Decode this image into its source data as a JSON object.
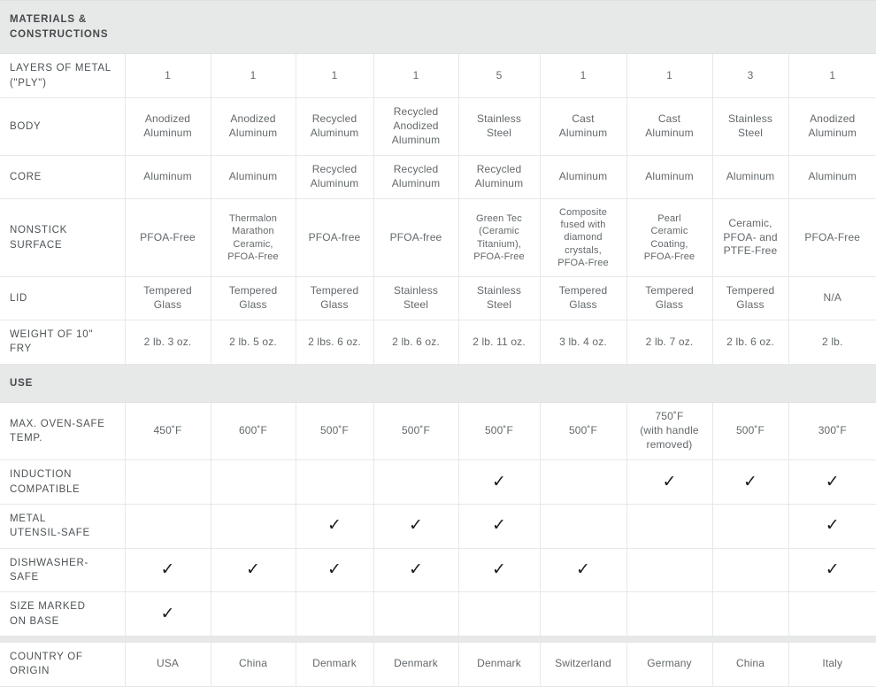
{
  "table": {
    "column_count": 9,
    "sections": [
      {
        "id": "materials",
        "title": "MATERIALS &\nCONSTRUCTIONS",
        "rows": [
          {
            "label": "LAYERS OF METAL\n(\"PLY\")",
            "cells": [
              "1",
              "1",
              "1",
              "1",
              "5",
              "1",
              "1",
              "3",
              "1"
            ]
          },
          {
            "label": "BODY",
            "cells": [
              "Anodized\nAluminum",
              "Anodized\nAluminum",
              "Recycled\nAluminum",
              "Recycled\nAnodized\nAluminum",
              "Stainless\nSteel",
              "Cast\nAluminum",
              "Cast\nAluminum",
              "Stainless\nSteel",
              "Anodized\nAluminum"
            ]
          },
          {
            "label": "CORE",
            "cells": [
              "Aluminum",
              "Aluminum",
              "Recycled\nAluminum",
              "Recycled\nAluminum",
              "Recycled\nAluminum",
              "Aluminum",
              "Aluminum",
              "Aluminum",
              "Aluminum"
            ]
          },
          {
            "label": "NONSTICK SURFACE",
            "cells": [
              "PFOA-Free",
              "Thermalon\nMarathon\nCeramic,\nPFOA-Free",
              "PFOA-free",
              "PFOA-free",
              "Green Tec\n(Ceramic\nTitanium),\nPFOA-Free",
              "Composite\nfused with\ndiamond\ncrystals,\nPFOA-Free",
              "Pearl\nCeramic\nCoating,\nPFOA-Free",
              "Ceramic,\nPFOA- and\nPTFE-Free",
              "PFOA-Free"
            ]
          },
          {
            "label": "LID",
            "cells": [
              "Tempered\nGlass",
              "Tempered\nGlass",
              "Tempered\nGlass",
              "Stainless\nSteel",
              "Stainless\nSteel",
              "Tempered\nGlass",
              "Tempered\nGlass",
              "Tempered\nGlass",
              "N/A"
            ]
          },
          {
            "label": "WEIGHT OF 10\" FRY",
            "cells": [
              "2 lb. 3 oz.",
              "2 lb. 5 oz.",
              "2 lbs. 6 oz.",
              "2 lb. 6 oz.",
              "2 lb. 11 oz.",
              "3 lb. 4 oz.",
              "2 lb. 7 oz.",
              "2 lb. 6 oz.",
              "2 lb."
            ]
          }
        ]
      },
      {
        "id": "use",
        "title": "USE",
        "rows": [
          {
            "label": "MAX. OVEN-SAFE\nTEMP.",
            "cells": [
              "450˚F",
              "600˚F",
              "500˚F",
              "500˚F",
              "500˚F",
              "500˚F",
              "750˚F\n(with handle\nremoved)",
              "500˚F",
              "300˚F"
            ]
          },
          {
            "label": "INDUCTION\nCOMPATIBLE",
            "cells": [
              "",
              "",
              "",
              "",
              "check",
              "",
              "check",
              "check",
              "check"
            ]
          },
          {
            "label": "METAL\nUTENSIL-SAFE",
            "cells": [
              "",
              "",
              "check",
              "check",
              "check",
              "",
              "",
              "",
              "check"
            ]
          },
          {
            "label": "DISHWASHER-SAFE",
            "cells": [
              "check",
              "check",
              "check",
              "check",
              "check",
              "check",
              "",
              "",
              "check"
            ]
          },
          {
            "label": "SIZE MARKED\nON BASE",
            "cells": [
              "check",
              "",
              "",
              "",
              "",
              "",
              "",
              "",
              ""
            ]
          },
          {
            "label": "COUNTRY OF\nORIGIN",
            "separator_above": true,
            "cells": [
              "USA",
              "China",
              "Denmark",
              "Denmark",
              "Denmark",
              "Switzerland",
              "Germany",
              "China",
              "Italy"
            ]
          }
        ]
      }
    ]
  },
  "glyphs": {
    "check": "✓"
  },
  "colors": {
    "section_band": "#e7e9e8",
    "grid_line": "#e6e8e7",
    "label_text": "#4d5255",
    "cell_text": "#63686b",
    "check": "#1a1a1a",
    "page_background": "#ffffff"
  }
}
